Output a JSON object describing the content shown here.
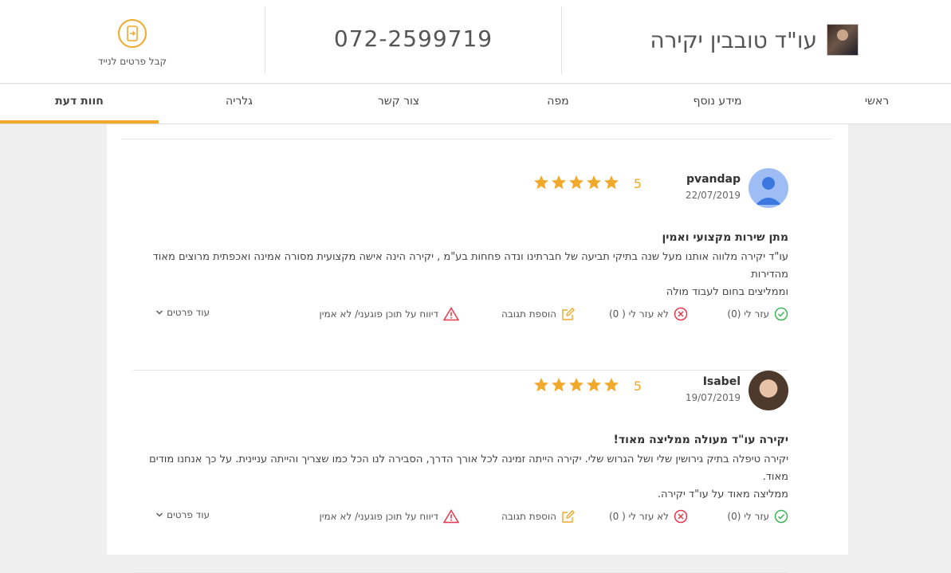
{
  "header": {
    "brand_name": "עו\"ד טובבין יקירה",
    "phone": "072-2599719",
    "mobile_cta": "קבל פרטים לנייד"
  },
  "nav": {
    "tabs": [
      {
        "label": "ראשי",
        "active": false
      },
      {
        "label": "מידע נוסף",
        "active": false
      },
      {
        "label": "מפה",
        "active": false
      },
      {
        "label": "צור קשר",
        "active": false
      },
      {
        "label": "גלריה",
        "active": false
      },
      {
        "label": "חוות דעת",
        "active": true
      }
    ]
  },
  "colors": {
    "accent": "#f0a92a",
    "success": "#3cb55a",
    "danger": "#e5394b"
  },
  "reviews": [
    {
      "name": "pvandap",
      "date": "22/07/2019",
      "rating": "5",
      "stars": 5,
      "avatar": "default-user-icon",
      "title": "מתן שירות מקצועי ואמין",
      "body_line1": "עו\"ד יקירה מלווה אותנו מעל שנה בתיקי תביעה של חברתינו ונדה פחחות בע\"מ , יקירה הינה אישה מקצועית מסורה אמינה ואכפתית מרוצים מאוד מהדירות",
      "body_line2": "וממליצים בחום לעבוד מולה",
      "actions": {
        "helpful": "עזר לי (0)",
        "not_helpful": "לא עזר לי ( 0)",
        "add_response": "הוספת תגובה",
        "report": "דיווח על תוכן פוגעני/ לא אמין",
        "more": "עוד פרטים"
      }
    },
    {
      "name": "Isabel",
      "date": "19/07/2019",
      "rating": "5",
      "stars": 5,
      "avatar": "user-photo",
      "title": "יקירה עו\"ד מעולה ממליצה מאוד!",
      "body_line1": "יקירה טיפלה בתיק גירושין שלי ושל הגרוש שלי. יקירה הייתה זמינה לכל אורך הדרך, הסבירה לנו הכל כמו שצריך והייתה עניינית. על כך אנחנו מודים מאוד.",
      "body_line2": "ממליצה מאוד על עו\"ד יקירה.",
      "actions": {
        "helpful": "עזר לי (0)",
        "not_helpful": "לא עזר לי ( 0)",
        "add_response": "הוספת תגובה",
        "report": "דיווח על תוכן פוגעני/ לא אמין",
        "more": "עוד פרטים"
      }
    }
  ]
}
